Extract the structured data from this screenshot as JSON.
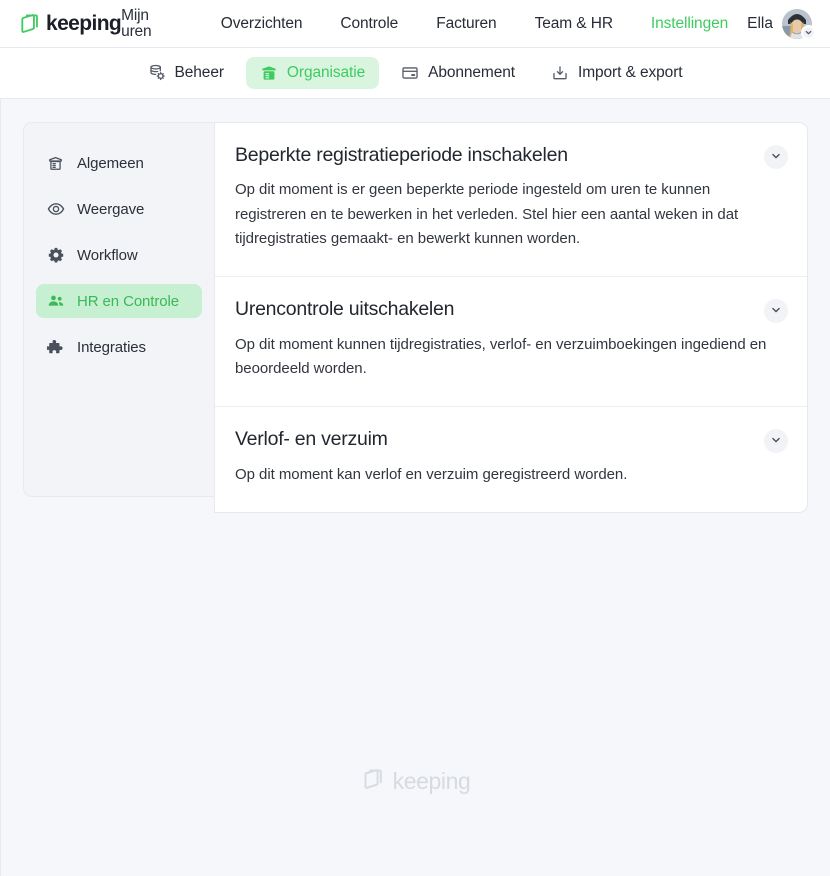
{
  "brand": {
    "name": "keeping",
    "tagline": "Mijn uren",
    "logo_icon": "keeping-logo-icon"
  },
  "colors": {
    "accent_green": "#3ecc5f",
    "accent_green_dark": "#3ab956",
    "active_pill_bg": "#d9f5df",
    "sidebar_active_bg": "#c7efd1",
    "page_bg": "#f6f7fa",
    "border": "#e7e9ee",
    "text": "#272c36",
    "watermark": "#d6dae1"
  },
  "topnav": {
    "items": [
      {
        "label": "Overzichten",
        "active": false
      },
      {
        "label": "Controle",
        "active": false
      },
      {
        "label": "Facturen",
        "active": false
      },
      {
        "label": "Team & HR",
        "active": false
      },
      {
        "label": "Instellingen",
        "active": true
      }
    ],
    "user": {
      "name": "Ella",
      "avatar_icon": "user-avatar-photo",
      "dropdown_icon": "chevron-down-icon"
    }
  },
  "subnav": {
    "items": [
      {
        "label": "Beheer",
        "icon": "server-gear-icon",
        "active": false
      },
      {
        "label": "Organisatie",
        "icon": "organisation-building-icon",
        "active": true
      },
      {
        "label": "Abonnement",
        "icon": "credit-card-icon",
        "active": false
      },
      {
        "label": "Import & export",
        "icon": "download-tray-icon",
        "active": false
      }
    ]
  },
  "sidebar": {
    "items": [
      {
        "label": "Algemeen",
        "icon": "building-icon",
        "active": false
      },
      {
        "label": "Weergave",
        "icon": "eye-icon",
        "active": false
      },
      {
        "label": "Workflow",
        "icon": "gear-icon",
        "active": false
      },
      {
        "label": "HR en Controle",
        "icon": "people-icon",
        "active": true
      },
      {
        "label": "Integraties",
        "icon": "puzzle-piece-icon",
        "active": false
      }
    ]
  },
  "main": {
    "cards": [
      {
        "title": "Beperkte registratieperiode inschakelen",
        "description": "Op dit moment is er geen beperkte periode ingesteld om uren te kunnen registreren en te bewerken in het verleden. Stel hier een aantal weken in dat tijdregistraties gemaakt- en bewerkt kunnen worden.",
        "toggle_icon": "chevron-down-icon"
      },
      {
        "title": "Urencontrole uitschakelen",
        "description": "Op dit moment kunnen tijdregistraties, verlof- en verzuimboekingen ingediend en beoordeeld worden.",
        "toggle_icon": "chevron-down-icon"
      },
      {
        "title": "Verlof- en verzuim",
        "description": "Op dit moment kan verlof en verzuim geregistreerd worden.",
        "toggle_icon": "chevron-down-icon"
      }
    ]
  },
  "footer": {
    "watermark_text": "keeping",
    "watermark_icon": "keeping-logo-icon"
  }
}
